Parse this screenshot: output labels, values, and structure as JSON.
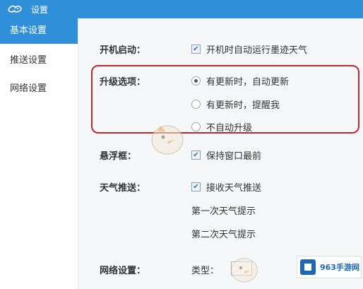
{
  "titlebar": {
    "title": "设置",
    "logo_icon": "cloud-bird-logo-icon"
  },
  "sidebar": {
    "items": [
      {
        "label": "基本设置",
        "active": true
      },
      {
        "label": "推送设置",
        "active": false
      },
      {
        "label": "网络设置",
        "active": false
      }
    ]
  },
  "startup": {
    "label": "开机启动：",
    "checkbox_label": "开机时自动运行墨迹天气",
    "checked": true
  },
  "upgrade": {
    "label": "升级选项：",
    "options": [
      {
        "label": "有更新时，自动更新",
        "selected": true
      },
      {
        "label": "有更新时，提醒我",
        "selected": false
      },
      {
        "label": "不自动升级",
        "selected": false
      }
    ]
  },
  "floating": {
    "label": "悬浮框：",
    "checkbox_label": "保持窗口最前",
    "checked": true
  },
  "weather_push": {
    "label": "天气推送：",
    "checkbox_label": "接收天气推送",
    "checked": true,
    "first_reminder": "第一次天气提示",
    "second_reminder": "第二次天气提示"
  },
  "network": {
    "label": "网络设置：",
    "type_label": "类型："
  },
  "badge": {
    "text": "963手游网"
  },
  "colors": {
    "accent": "#2f8fd8",
    "highlight_border": "#c0282d"
  }
}
